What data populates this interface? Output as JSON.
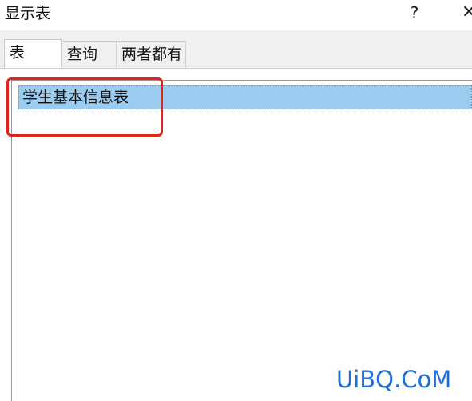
{
  "window": {
    "title": "显示表",
    "help_label": "?",
    "close_label": "✕"
  },
  "tabs": [
    {
      "label": "表",
      "active": true
    },
    {
      "label": "查询",
      "active": false
    },
    {
      "label": "两者都有",
      "active": false
    }
  ],
  "list": {
    "items": [
      {
        "label": "学生基本信息表",
        "selected": true
      }
    ]
  },
  "annotation": {
    "color": "#e0241b"
  },
  "watermark": "UiBQ.CoM"
}
